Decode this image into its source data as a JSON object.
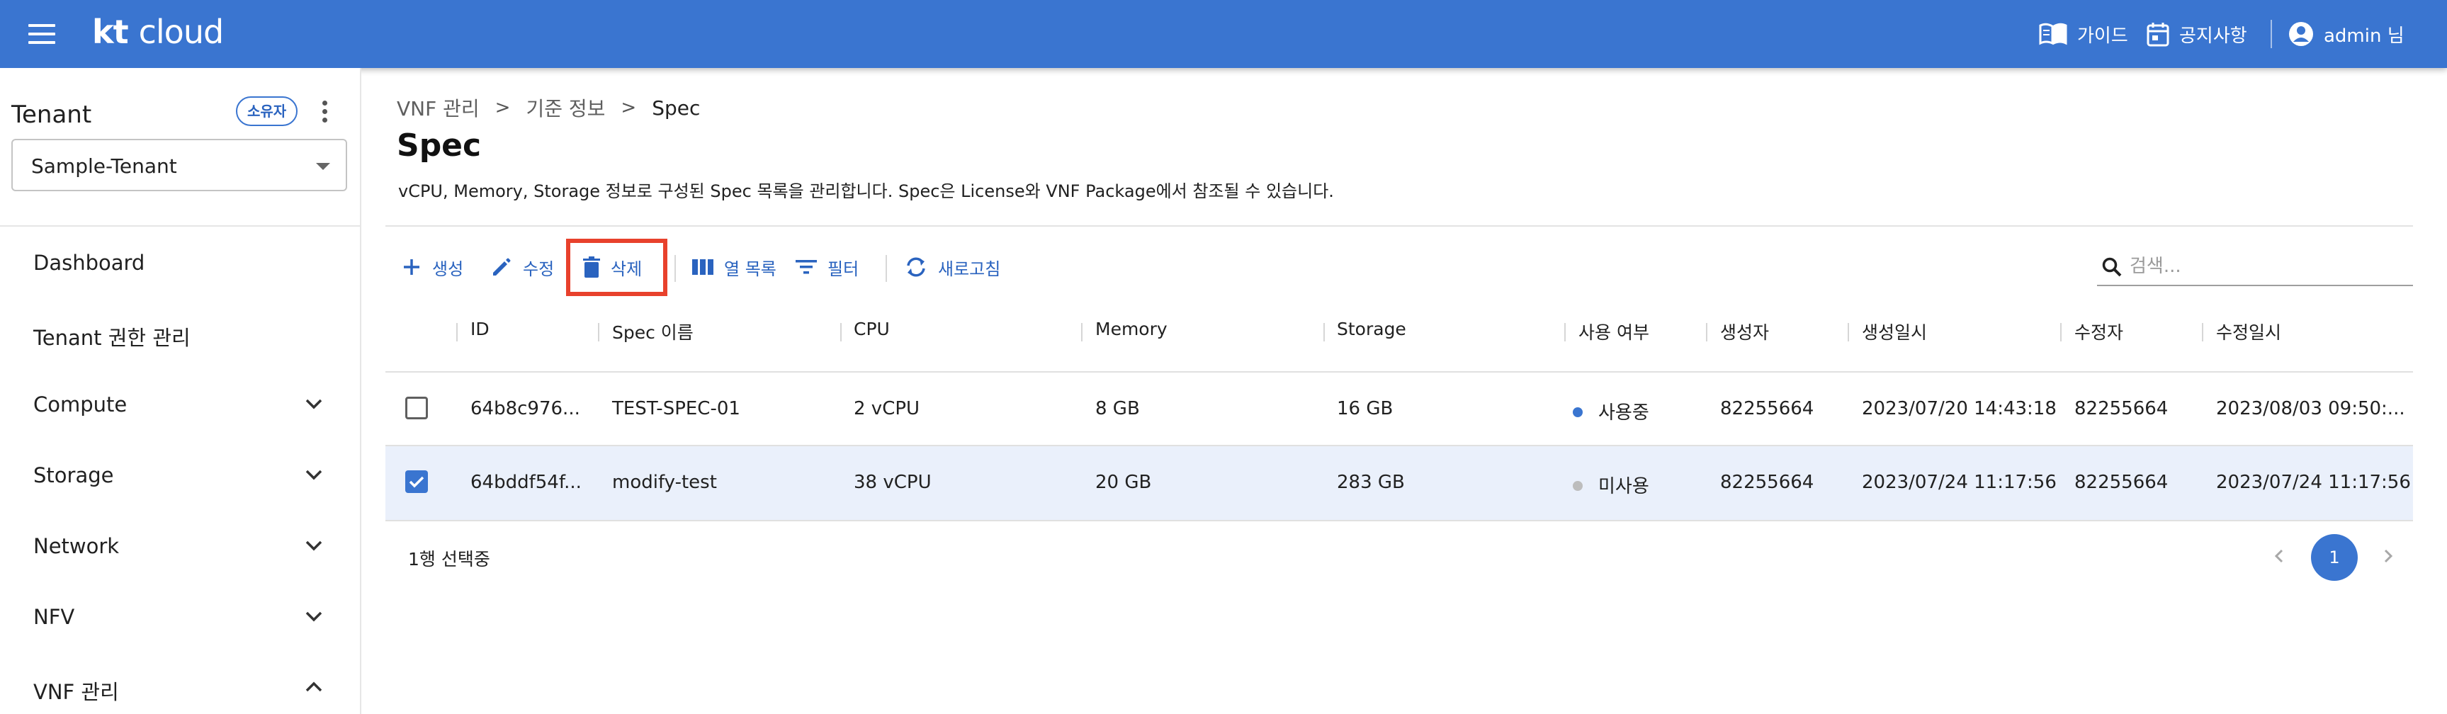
{
  "header": {
    "logo_kt": "kt",
    "logo_cloud": "cloud",
    "guide_label": "가이드",
    "notice_label": "공지사항",
    "user_label": "admin 님",
    "color": "#3a75d0"
  },
  "sidebar": {
    "tenant_title": "Tenant",
    "owner_badge": "소유자",
    "tenant_select_value": "Sample-Tenant",
    "items": [
      {
        "label": "Dashboard",
        "icon": ""
      },
      {
        "label": "Tenant 권한 관리",
        "icon": ""
      },
      {
        "label": "Compute",
        "icon": "chevron-down-icon"
      },
      {
        "label": "Storage",
        "icon": "chevron-down-icon"
      },
      {
        "label": "Network",
        "icon": "chevron-down-icon"
      },
      {
        "label": "NFV",
        "icon": "chevron-down-icon"
      },
      {
        "label": "VNF 관리",
        "icon": "chevron-up-icon"
      }
    ]
  },
  "breadcrumb": {
    "items": [
      "VNF 관리",
      "기준 정보",
      "Spec"
    ],
    "separator": ">"
  },
  "page": {
    "title": "Spec",
    "description": "vCPU, Memory, Storage 정보로 구성된 Spec 목록을 관리합니다. Spec은 License와 VNF Package에서 참조될 수 있습니다."
  },
  "toolbar": {
    "create_label": "생성",
    "edit_label": "수정",
    "delete_label": "삭제",
    "columns_label": "열 목록",
    "filter_label": "필터",
    "refresh_label": "새로고침",
    "highlight_color": "#e8412c"
  },
  "search": {
    "placeholder": "검색..."
  },
  "table": {
    "columns": [
      "ID",
      "Spec 이름",
      "CPU",
      "Memory",
      "Storage",
      "사용 여부",
      "생성자",
      "생성일시",
      "수정자",
      "수정일시"
    ],
    "rows": [
      {
        "selected": false,
        "id": "64b8c976...",
        "name": "TEST-SPEC-01",
        "cpu": "2 vCPU",
        "memory": "8 GB",
        "storage": "16 GB",
        "status": "사용중",
        "status_color": "#3a75d0",
        "creator": "82255664",
        "created_at": "2023/07/20 14:43:18",
        "modifier": "82255664",
        "modified_at": "2023/08/03 09:50:..."
      },
      {
        "selected": true,
        "id": "64bddf54f...",
        "name": "modify-test",
        "cpu": "38 vCPU",
        "memory": "20 GB",
        "storage": "283 GB",
        "status": "미사용",
        "status_color": "#bdbdbd",
        "creator": "82255664",
        "created_at": "2023/07/24 11:17:56",
        "modifier": "82255664",
        "modified_at": "2023/07/24 11:17:56"
      }
    ]
  },
  "footer": {
    "selected_text": "1행 선택중",
    "current_page": "1"
  }
}
